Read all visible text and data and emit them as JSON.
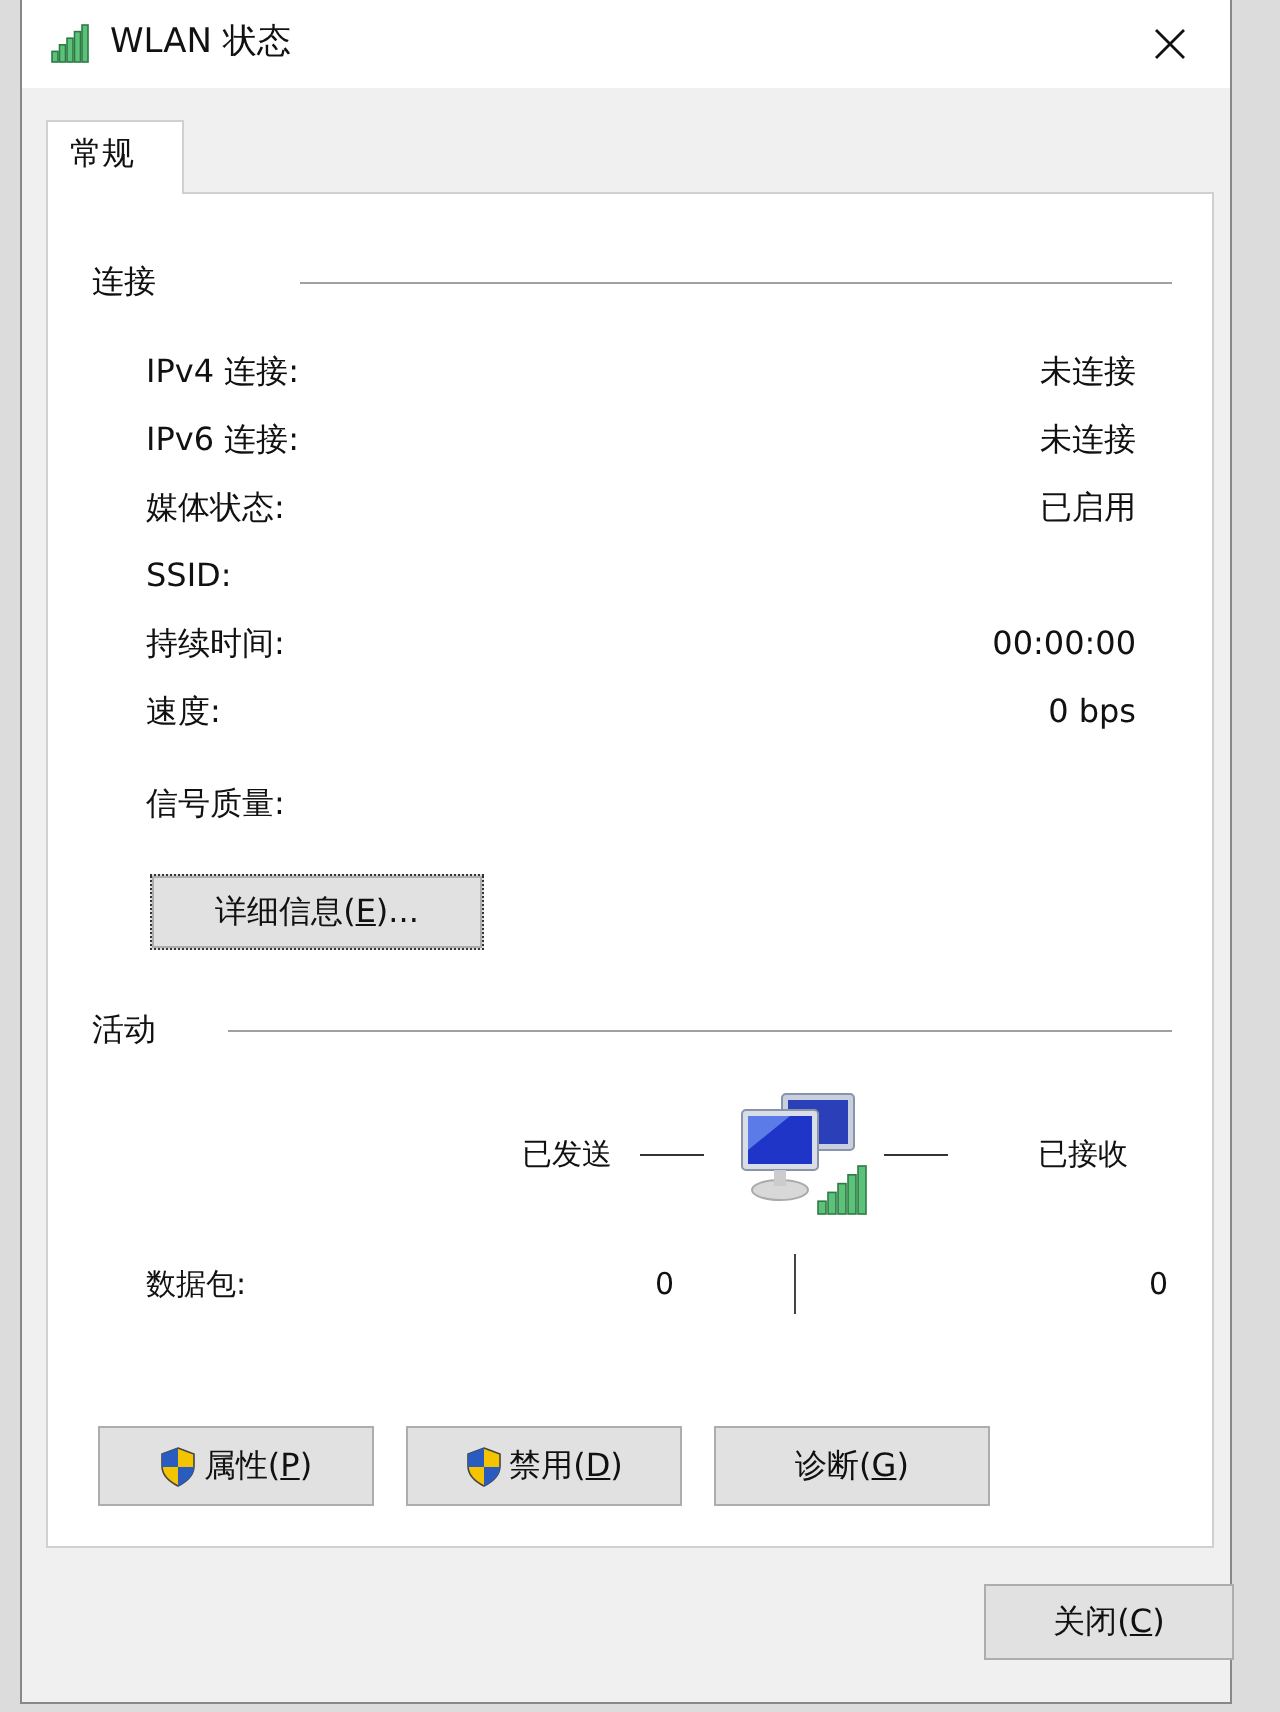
{
  "window": {
    "title": "WLAN 状态"
  },
  "tabs": [
    {
      "label": "常规",
      "selected": true
    }
  ],
  "connection": {
    "heading": "连接",
    "rows": [
      {
        "label": "IPv4 连接:",
        "value": "未连接"
      },
      {
        "label": "IPv6 连接:",
        "value": "未连接"
      },
      {
        "label": "媒体状态:",
        "value": "已启用"
      },
      {
        "label": "SSID:"
      },
      {
        "label": "持续时间:",
        "value": "00:00:00"
      },
      {
        "label": "速度:",
        "value": "0 bps"
      }
    ],
    "signal_label": "信号质量:",
    "details_button": {
      "before": "详细信息(",
      "key": "E",
      "after": ")..."
    }
  },
  "activity": {
    "heading": "活动",
    "sent_label": "已发送",
    "received_label": "已接收",
    "rows": [
      {
        "label": "数据包:",
        "sent": "0",
        "received": "0"
      }
    ]
  },
  "buttons": [
    {
      "before": "属性(",
      "key": "P",
      "after": ")",
      "shield": true
    },
    {
      "before": "禁用(",
      "key": "D",
      "after": ")",
      "shield": true
    },
    {
      "before": "诊断(",
      "key": "G",
      "after": ")",
      "shield": false
    }
  ],
  "close_button": {
    "before": "关闭(",
    "key": "C",
    "after": ")"
  }
}
